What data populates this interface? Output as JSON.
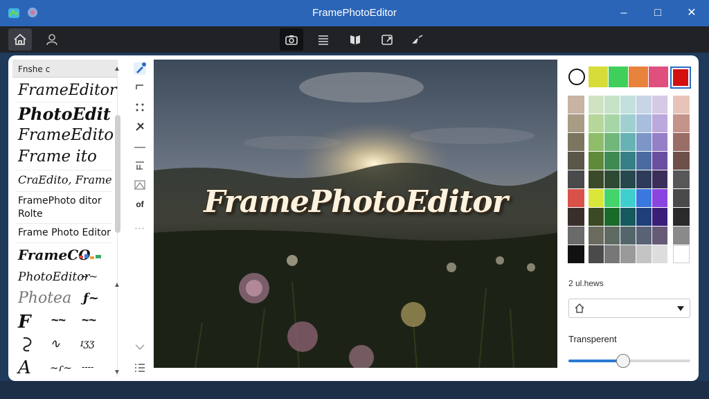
{
  "window": {
    "title": "FramePhotoEditor"
  },
  "toolbar": {
    "left_icons": [
      "home-icon",
      "user-icon"
    ],
    "center_icons": [
      "camera-icon",
      "text-lines-icon",
      "book-icon",
      "crop-icon",
      "sparkle-icon"
    ]
  },
  "font_panel": {
    "search_value": "Fnshe c",
    "fonts": [
      "FrameEditor",
      "PhotoEdit",
      "FrameEdito",
      "Frame  ito",
      "CraEdito, Frame",
      "FramePhoto ditor",
      "Rolte",
      "Frame Photo  Editor",
      "FrameCO",
      "PhotoEditor",
      "Photea",
      "F",
      "A"
    ],
    "row_glyphs": [
      "~~",
      "ƒ~",
      "~~",
      "~~",
      "∿",
      "ɪʒʒ",
      "~ɾ~",
      "----"
    ]
  },
  "tool_strip": {
    "font_label": "of",
    "more": "···"
  },
  "photo": {
    "overlay_text": "FramePhotoEditor"
  },
  "color_panel": {
    "top_swatches": [
      "#d8dc3a",
      "#3fcf5a",
      "#e7833d",
      "#e0507e",
      "#d40f0f"
    ],
    "selected_color": "#d40f0f",
    "label": "2 ul.hews",
    "transparency_label": "Transperent",
    "transparency_value": 0.45
  }
}
